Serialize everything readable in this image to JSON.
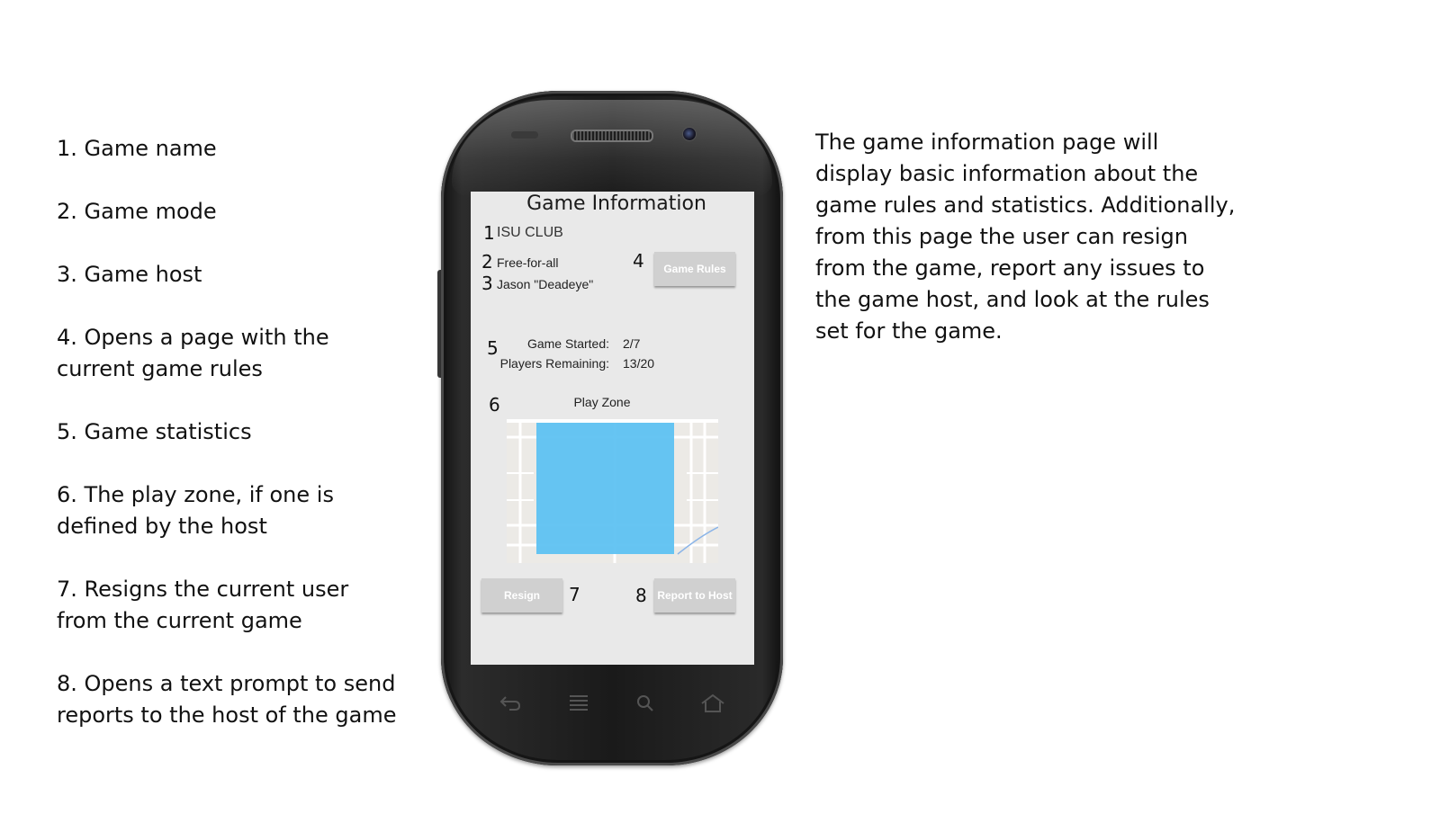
{
  "annotations": [
    "1. Game name",
    "2. Game mode",
    "3. Game host",
    "4. Opens a page with the current game rules",
    "5. Game statistics",
    "6. The play zone, if one is defined by the host",
    "7. Resigns the current user from the current game",
    "8. Opens a text prompt to send reports to the host of the game"
  ],
  "description": "The game information page will display basic information about the game rules and statistics. Additionally, from this page the user can resign from the game, report any issues to the game host, and look at the rules set for the game.",
  "screen": {
    "title": "Game Information",
    "markers": [
      "1",
      "2",
      "3",
      "4",
      "5",
      "6",
      "7",
      "8"
    ],
    "game_name": "ISU CLUB",
    "game_mode": "Free-for-all",
    "game_host": "Jason \"Deadeye\"",
    "game_rules_button": "Game Rules",
    "stats": {
      "started_label": "Game Started:",
      "started_value": "2/7",
      "remaining_label": "Players Remaining:",
      "remaining_value": "13/20"
    },
    "play_zone_label": "Play Zone",
    "resign_button": "Resign",
    "report_button": "Report to Host"
  },
  "colors": {
    "screen_bg": "#e9e9e9",
    "button_bg": "#d0d0d0",
    "zone_fill": "#5ec2f2"
  },
  "icons": [
    "back-icon",
    "menu-icon",
    "search-icon",
    "home-icon"
  ]
}
